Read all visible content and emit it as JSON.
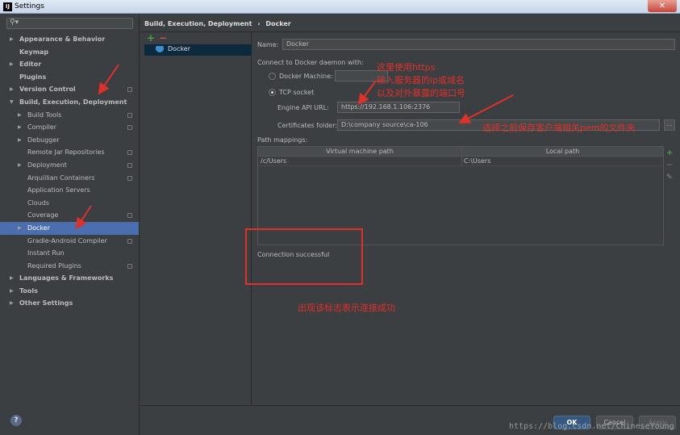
{
  "window": {
    "app_icon": "intellij-icon",
    "title": "Settings",
    "close_icon": "close-icon"
  },
  "search": {
    "icon": "search-icon",
    "value": ""
  },
  "tree": [
    {
      "label": "Appearance & Behavior",
      "level": 0,
      "arrow": "▶",
      "bold": true,
      "cfg": false
    },
    {
      "label": "Keymap",
      "level": 0,
      "arrow": "",
      "bold": true,
      "cfg": false
    },
    {
      "label": "Editor",
      "level": 0,
      "arrow": "▶",
      "bold": true,
      "cfg": false
    },
    {
      "label": "Plugins",
      "level": 0,
      "arrow": "",
      "bold": true,
      "cfg": false
    },
    {
      "label": "Version Control",
      "level": 0,
      "arrow": "▶",
      "bold": true,
      "cfg": true
    },
    {
      "label": "Build, Execution, Deployment",
      "level": 0,
      "arrow": "▼",
      "bold": true,
      "cfg": false
    },
    {
      "label": "Build Tools",
      "level": 1,
      "arrow": "▶",
      "bold": false,
      "cfg": true
    },
    {
      "label": "Compiler",
      "level": 1,
      "arrow": "▶",
      "bold": false,
      "cfg": true
    },
    {
      "label": "Debugger",
      "level": 1,
      "arrow": "▶",
      "bold": false,
      "cfg": false
    },
    {
      "label": "Remote Jar Repositories",
      "level": 1,
      "arrow": "",
      "bold": false,
      "cfg": true
    },
    {
      "label": "Deployment",
      "level": 1,
      "arrow": "▶",
      "bold": false,
      "cfg": true
    },
    {
      "label": "Arquillian Containers",
      "level": 1,
      "arrow": "",
      "bold": false,
      "cfg": true
    },
    {
      "label": "Application Servers",
      "level": 1,
      "arrow": "",
      "bold": false,
      "cfg": false
    },
    {
      "label": "Clouds",
      "level": 1,
      "arrow": "",
      "bold": false,
      "cfg": false
    },
    {
      "label": "Coverage",
      "level": 1,
      "arrow": "",
      "bold": false,
      "cfg": true
    },
    {
      "label": "Docker",
      "level": 1,
      "arrow": "▶",
      "bold": false,
      "cfg": false,
      "selected": true
    },
    {
      "label": "Gradle-Android Compiler",
      "level": 1,
      "arrow": "",
      "bold": false,
      "cfg": true
    },
    {
      "label": "Instant Run",
      "level": 1,
      "arrow": "",
      "bold": false,
      "cfg": false
    },
    {
      "label": "Required Plugins",
      "level": 1,
      "arrow": "",
      "bold": false,
      "cfg": true
    },
    {
      "label": "Languages & Frameworks",
      "level": 0,
      "arrow": "▶",
      "bold": true,
      "cfg": false
    },
    {
      "label": "Tools",
      "level": 0,
      "arrow": "▶",
      "bold": true,
      "cfg": false
    },
    {
      "label": "Other Settings",
      "level": 0,
      "arrow": "▶",
      "bold": true,
      "cfg": false
    }
  ],
  "breadcrumb": {
    "parent": "Build, Execution, Deployment",
    "separator": "›",
    "current": "Docker"
  },
  "docker_list": {
    "add": "+",
    "remove": "−",
    "item": "Docker",
    "item_icon": "docker-whale-icon"
  },
  "form": {
    "name_label": "Name:",
    "name_value": "Docker",
    "connect_label": "Connect to Docker daemon with:",
    "docker_machine_label": "Docker Machine:",
    "docker_machine_value": "",
    "tcp_socket_label": "TCP socket",
    "engine_api_label": "Engine API URL:",
    "engine_api_value": "https://192.168.1.106:2376",
    "cert_folder_label": "Certificates folder:",
    "cert_folder_value": "D:\\company source\\ca-106",
    "browse": "...",
    "path_mappings_label": "Path mappings:"
  },
  "path_mappings": {
    "columns": [
      "Virtual machine path",
      "Local path"
    ],
    "rows": [
      [
        "/c/Users",
        "C:\\Users"
      ]
    ],
    "add": "+",
    "remove": "−",
    "edit_icon": "pencil-icon"
  },
  "status": {
    "connection": "Connection successful"
  },
  "annotations": {
    "note_tcp": [
      "这里使用https",
      "输入服务器的ip或域名",
      "以及对外暴露的端口号"
    ],
    "note_cert": "选择之前保存客户端相关pem的文件夹",
    "note_success": "出现该标志表示连接成功",
    "color": "#e0302a"
  },
  "footer": {
    "help": "?",
    "ok": "OK",
    "cancel": "Cancel",
    "apply": "Apply",
    "watermark": "https://blog.csdn.net/ChineseYoung"
  },
  "colors": {
    "background": "#3c3f41",
    "selection": "#4b6eaf",
    "ok_button": "#365880"
  }
}
